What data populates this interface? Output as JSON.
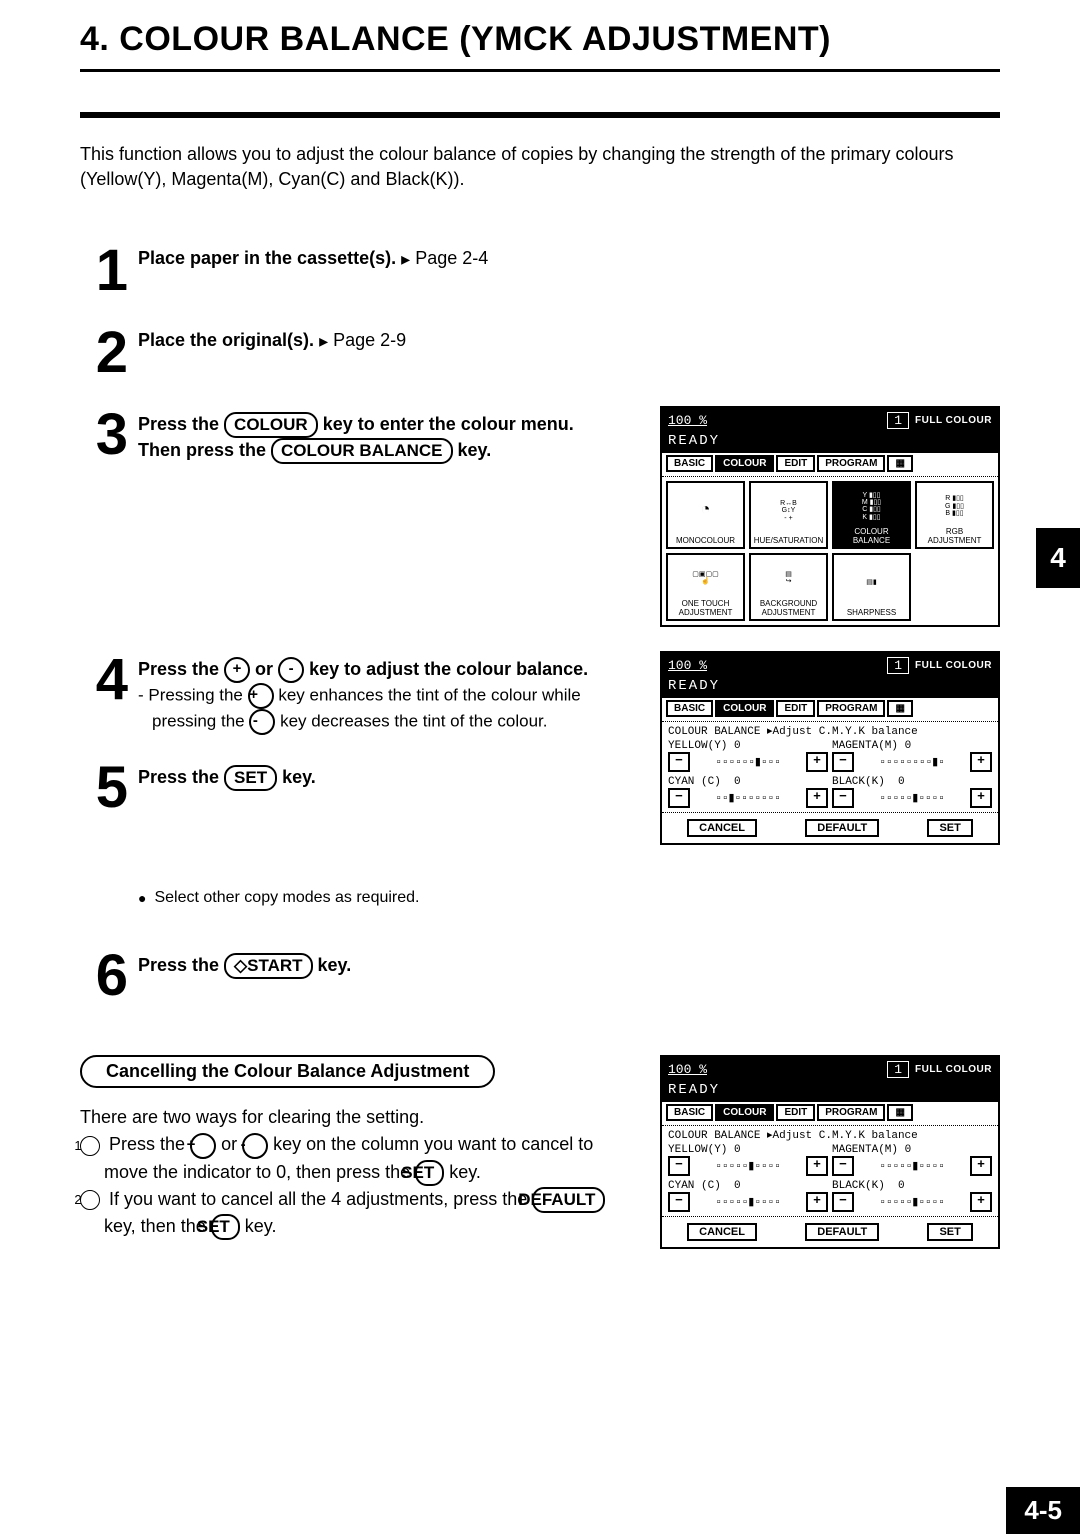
{
  "title": "4. COLOUR BALANCE (YMCK ADJUSTMENT)",
  "intro": "This function allows you to adjust the colour balance of copies by changing the strength of the primary colours (Yellow(Y), Magenta(M), Cyan(C) and Black(K)).",
  "section_tab_label": "4",
  "page_number": "4-5",
  "steps": [
    {
      "num": "1",
      "lead": "Place paper in the cassette(s).",
      "ref": "Page 2-4"
    },
    {
      "num": "2",
      "lead": "Place the original(s).",
      "ref": "Page 2-9"
    },
    {
      "num": "3",
      "line1_a": "Press the ",
      "line1_key": "COLOUR",
      "line1_b": " key to enter the colour menu.",
      "line2_a": "Then press the ",
      "line2_key": "COLOUR BALANCE",
      "line2_b": " key."
    },
    {
      "num": "4",
      "lead_a": "Press the ",
      "plus": "+",
      "or": " or ",
      "minus": "-",
      "lead_b": " key to adjust the colour balance.",
      "sub_a": "- Pressing the ",
      "sub_plus": "+",
      "sub_b": " key enhances the tint of the colour while pressing the ",
      "sub_minus": "-",
      "sub_c": " key decreases the tint of the colour."
    },
    {
      "num": "5",
      "lead_a": "Press the ",
      "key": "SET",
      "lead_b": " key."
    },
    {
      "num": "6",
      "lead_a": "Press the ",
      "key": "◇START",
      "lead_b": " key."
    }
  ],
  "select_note": "Select other copy modes as required.",
  "cancel": {
    "heading": "Cancelling the Colour Balance Adjustment",
    "intro": "There are two ways for clearing the setting.",
    "opt1_a": "Press the ",
    "opt1_plus": "+",
    "opt1_or": " or ",
    "opt1_minus": "-",
    "opt1_b": " key on the column you want to cancel to move the indicator to 0, then press the ",
    "opt1_key": "SET",
    "opt1_c": " key.",
    "opt2_a": "If you want to cancel all the 4 adjustments, press the ",
    "opt2_key1": "DEFAULT",
    "opt2_b": " key, then the ",
    "opt2_key2": "SET",
    "opt2_c": " key."
  },
  "screens": {
    "common": {
      "percent": "100  %",
      "count": "1",
      "fullcolour": "FULL COLOUR",
      "ready": "READY",
      "tabs": [
        "BASIC",
        "COLOUR",
        "EDIT",
        "PROGRAM"
      ],
      "icon_tab": "▦"
    },
    "menu": {
      "items": [
        {
          "label": "MONOCOLOUR",
          "icon": "◔"
        },
        {
          "label": "HUE/SATURATION",
          "icon": "R↔B\nG↕Y\n-  +"
        },
        {
          "label": "COLOUR BALANCE",
          "selected": true,
          "icon_lines": [
            "Y ▮▯▯",
            "M ▮▯▯",
            "C ▮▯▯",
            "K ▮▯▯"
          ]
        },
        {
          "label": "RGB ADJUSTMENT",
          "icon_lines": [
            "R ▮▯▯",
            "G ▮▯▯",
            "B ▮▯▯"
          ]
        },
        {
          "label": "ONE TOUCH ADJUSTMENT",
          "icon": "▢▣▢▢\n☝"
        },
        {
          "label": "BACKGROUND ADJUSTMENT",
          "icon": "▤\n↪"
        },
        {
          "label": "SHARPNESS",
          "icon": "▤▮"
        }
      ]
    },
    "balance_shifted": {
      "subtitle": "COLOUR BALANCE ▸Adjust C.M.Y.K balance",
      "channels": [
        {
          "name": "YELLOW(Y)",
          "zero": "0",
          "track": "▫▫▫▫▫▫▮▫▫▫"
        },
        {
          "name": "MAGENTA(M)",
          "zero": "0",
          "track": "▫▫▫▫▫▫▫▫▮▫"
        },
        {
          "name": "CYAN (C)",
          "zero": "0",
          "track": "▫▫▮▫▫▫▫▫▫▫"
        },
        {
          "name": "BLACK(K)",
          "zero": "0",
          "track": "▫▫▫▫▫▮▫▫▫▫"
        }
      ],
      "actions": [
        "CANCEL",
        "DEFAULT",
        "SET"
      ]
    },
    "balance_center": {
      "subtitle": "COLOUR BALANCE ▸Adjust C.M.Y.K balance",
      "channels": [
        {
          "name": "YELLOW(Y)",
          "zero": "0",
          "track": "▫▫▫▫▫▮▫▫▫▫"
        },
        {
          "name": "MAGENTA(M)",
          "zero": "0",
          "track": "▫▫▫▫▫▮▫▫▫▫"
        },
        {
          "name": "CYAN (C)",
          "zero": "0",
          "track": "▫▫▫▫▫▮▫▫▫▫"
        },
        {
          "name": "BLACK(K)",
          "zero": "0",
          "track": "▫▫▫▫▫▮▫▫▫▫"
        }
      ],
      "actions": [
        "CANCEL",
        "DEFAULT",
        "SET"
      ]
    }
  }
}
